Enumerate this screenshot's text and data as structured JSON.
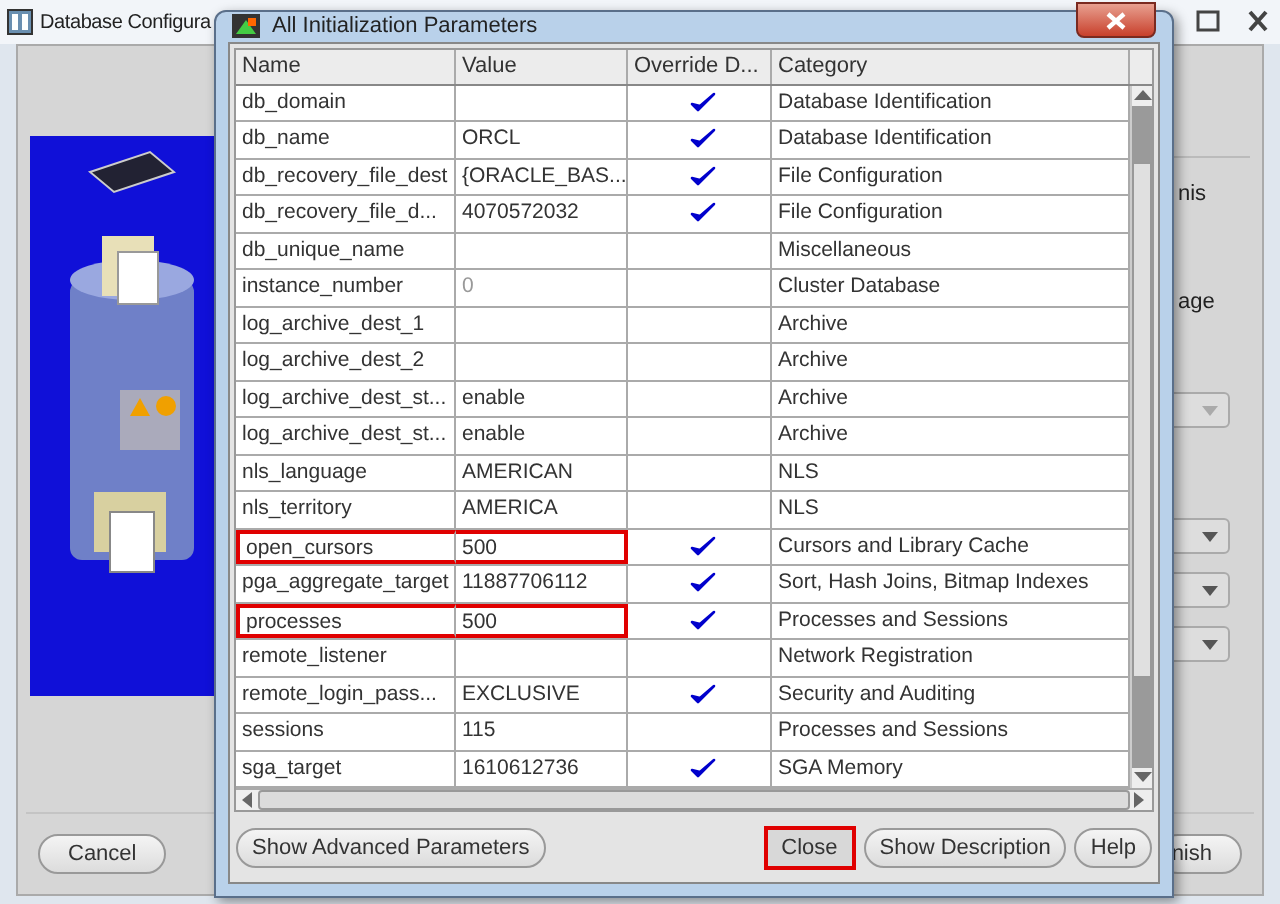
{
  "main_window": {
    "title": "Database Configura",
    "side_texts": [
      "nis",
      "age"
    ],
    "buttons": [
      "Cancel",
      "nish"
    ]
  },
  "dialog": {
    "title": "All Initialization Parameters",
    "columns": [
      "Name",
      "Value",
      "Override D...",
      "Category"
    ],
    "rows": [
      {
        "name": "db_domain",
        "value": "",
        "override": true,
        "category": "Database Identification",
        "highlighted": false,
        "value_greyed": false
      },
      {
        "name": "db_name",
        "value": "ORCL",
        "override": true,
        "category": "Database Identification",
        "highlighted": false,
        "value_greyed": false
      },
      {
        "name": "db_recovery_file_dest",
        "value": "{ORACLE_BAS...",
        "override": true,
        "category": "File Configuration",
        "highlighted": false,
        "value_greyed": false
      },
      {
        "name": "db_recovery_file_d...",
        "value": "4070572032",
        "override": true,
        "category": "File Configuration",
        "highlighted": false,
        "value_greyed": false
      },
      {
        "name": "db_unique_name",
        "value": "",
        "override": false,
        "category": "Miscellaneous",
        "highlighted": false,
        "value_greyed": false
      },
      {
        "name": "instance_number",
        "value": "0",
        "override": false,
        "category": "Cluster Database",
        "highlighted": false,
        "value_greyed": true
      },
      {
        "name": "log_archive_dest_1",
        "value": "",
        "override": false,
        "category": "Archive",
        "highlighted": false,
        "value_greyed": false
      },
      {
        "name": "log_archive_dest_2",
        "value": "",
        "override": false,
        "category": "Archive",
        "highlighted": false,
        "value_greyed": false
      },
      {
        "name": "log_archive_dest_st...",
        "value": "enable",
        "override": false,
        "category": "Archive",
        "highlighted": false,
        "value_greyed": false
      },
      {
        "name": "log_archive_dest_st...",
        "value": "enable",
        "override": false,
        "category": "Archive",
        "highlighted": false,
        "value_greyed": false
      },
      {
        "name": "nls_language",
        "value": "AMERICAN",
        "override": false,
        "category": "NLS",
        "highlighted": false,
        "value_greyed": false
      },
      {
        "name": "nls_territory",
        "value": "AMERICA",
        "override": false,
        "category": "NLS",
        "highlighted": false,
        "value_greyed": false
      },
      {
        "name": "open_cursors",
        "value": "500",
        "override": true,
        "category": "Cursors and Library Cache",
        "highlighted": true,
        "value_greyed": false
      },
      {
        "name": "pga_aggregate_target",
        "value": "11887706112",
        "override": true,
        "category": "Sort, Hash Joins, Bitmap Indexes",
        "highlighted": false,
        "value_greyed": false
      },
      {
        "name": "processes",
        "value": "500",
        "override": true,
        "category": "Processes and Sessions",
        "highlighted": true,
        "value_greyed": false
      },
      {
        "name": "remote_listener",
        "value": "",
        "override": false,
        "category": "Network Registration",
        "highlighted": false,
        "value_greyed": false
      },
      {
        "name": "remote_login_pass...",
        "value": "EXCLUSIVE",
        "override": true,
        "category": "Security and Auditing",
        "highlighted": false,
        "value_greyed": false
      },
      {
        "name": "sessions",
        "value": "115",
        "override": false,
        "category": "Processes and Sessions",
        "highlighted": false,
        "value_greyed": false
      },
      {
        "name": "sga_target",
        "value": "1610612736",
        "override": true,
        "category": "SGA Memory",
        "highlighted": false,
        "value_greyed": false
      }
    ],
    "buttons": [
      {
        "label": "Show Advanced Parameters",
        "highlighted": false
      },
      {
        "label": "Close",
        "highlighted": true
      },
      {
        "label": "Show Description",
        "highlighted": false
      },
      {
        "label": "Help",
        "highlighted": false
      }
    ]
  }
}
